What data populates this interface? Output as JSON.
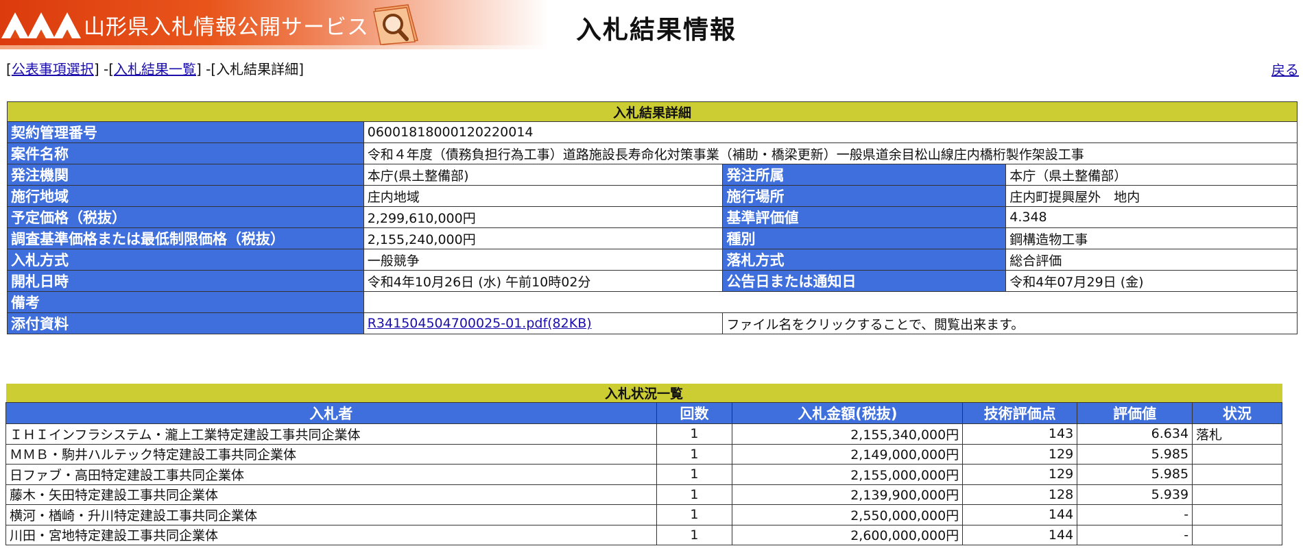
{
  "header": {
    "brand": "山形県入札情報公開サービス",
    "page_title": "入札結果情報",
    "brand_color": "#dc3b0d",
    "icons": [
      "logo-mountains-icon",
      "magnifier-folder-icon"
    ]
  },
  "nav": {
    "links": [
      "公表事項選択",
      "入札結果一覧"
    ],
    "current": "入札結果詳細",
    "back": "戻る"
  },
  "detail": {
    "caption": "入札結果詳細",
    "contract_no": {
      "label": "契約管理番号",
      "value": "06001818000120220014"
    },
    "project": {
      "label": "案件名称",
      "value": "令和４年度（債務負担行為工事）道路施設長寿命化対策事業（補助・橋梁更新）一般県道余目松山線庄内橋桁製作架設工事"
    },
    "agency": {
      "label": "発注機関",
      "value": "本庁(県土整備部)"
    },
    "office": {
      "label": "発注所属",
      "value": "本庁（県土整備部）"
    },
    "area": {
      "label": "施行地域",
      "value": "庄内地域"
    },
    "location": {
      "label": "施行場所",
      "value": "庄内町提興屋外　地内"
    },
    "planned_price": {
      "label": "予定価格（税抜）",
      "value": "2,299,610,000円"
    },
    "base_eval": {
      "label": "基準評価値",
      "value": "4.348"
    },
    "min_price": {
      "label": "調査基準価格または最低制限価格（税抜）",
      "value": "2,155,240,000円"
    },
    "category": {
      "label": "種別",
      "value": "鋼構造物工事"
    },
    "bid_method": {
      "label": "入札方式",
      "value": "一般競争"
    },
    "award_method": {
      "label": "落札方式",
      "value": "総合評価"
    },
    "open_date": {
      "label": "開札日時",
      "value": "令和4年10月26日 (水) 午前10時02分"
    },
    "notice_date": {
      "label": "公告日または通知日",
      "value": "令和4年07月29日 (金)"
    },
    "remarks": {
      "label": "備考",
      "value": ""
    },
    "attachment": {
      "label": "添付資料",
      "link": "R341504504700025-01.pdf(82KB)",
      "note": "ファイル名をクリックすることで、閲覧出来ます。"
    }
  },
  "bids": {
    "caption": "入札状況一覧",
    "columns": [
      "入札者",
      "回数",
      "入札金額(税抜)",
      "技術評価点",
      "評価値",
      "状況"
    ],
    "rows": [
      [
        "ＩＨＩインフラシステム・瀧上工業特定建設工事共同企業体",
        "1",
        "2,155,340,000円",
        "143",
        "6.634",
        "落札"
      ],
      [
        "ＭＭＢ・駒井ハルテック特定建設工事共同企業体",
        "1",
        "2,149,000,000円",
        "129",
        "5.985",
        ""
      ],
      [
        "日ファブ・高田特定建設工事共同企業体",
        "1",
        "2,155,000,000円",
        "129",
        "5.985",
        ""
      ],
      [
        "藤木・矢田特定建設工事共同企業体",
        "1",
        "2,139,900,000円",
        "128",
        "5.939",
        ""
      ],
      [
        "横河・楢崎・升川特定建設工事共同企業体",
        "1",
        "2,550,000,000円",
        "144",
        "-",
        ""
      ],
      [
        "川田・宮地特定建設工事共同企業体",
        "1",
        "2,600,000,000円",
        "144",
        "-",
        ""
      ]
    ]
  }
}
